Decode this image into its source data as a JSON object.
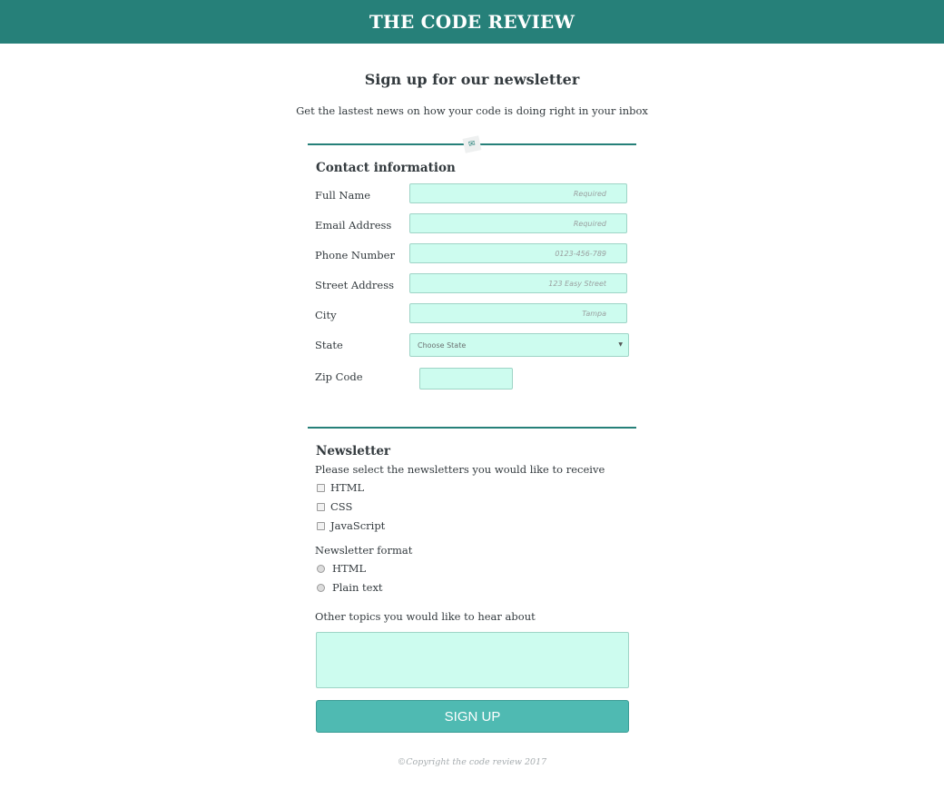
{
  "header": {
    "title": "THE CODE REVIEW"
  },
  "intro": {
    "heading": "Sign up for our newsletter",
    "subheading": "Get the lastest news on how your code is doing right in your inbox"
  },
  "contact": {
    "title": "Contact information",
    "fields": [
      {
        "label": "Full Name",
        "placeholder": "Required"
      },
      {
        "label": "Email Address",
        "placeholder": "Required"
      },
      {
        "label": "Phone Number",
        "placeholder": "0123-456-789"
      },
      {
        "label": "Street Address",
        "placeholder": "123 Easy Street"
      },
      {
        "label": "City",
        "placeholder": "Tampa"
      }
    ],
    "state": {
      "label": "State",
      "selected": "Choose State"
    },
    "zip": {
      "label": "Zip Code"
    }
  },
  "newsletter": {
    "title": "Newsletter",
    "select_prompt": "Please select the newsletters you would like to receive",
    "options": [
      "HTML",
      "CSS",
      "JavaScript"
    ],
    "format_label": "Newsletter format",
    "formats": [
      "HTML",
      "Plain text"
    ],
    "topics_label": "Other topics you would like to hear about"
  },
  "submit": {
    "label": "SIGN UP"
  },
  "footer": {
    "text": "©Copyright the code review 2017"
  },
  "icons": {
    "divider": "ribbon-icon"
  },
  "colors": {
    "header_bg": "#268079",
    "field_bg": "#cdfcef",
    "button_bg": "#4fbab2",
    "divider": "#268079"
  }
}
